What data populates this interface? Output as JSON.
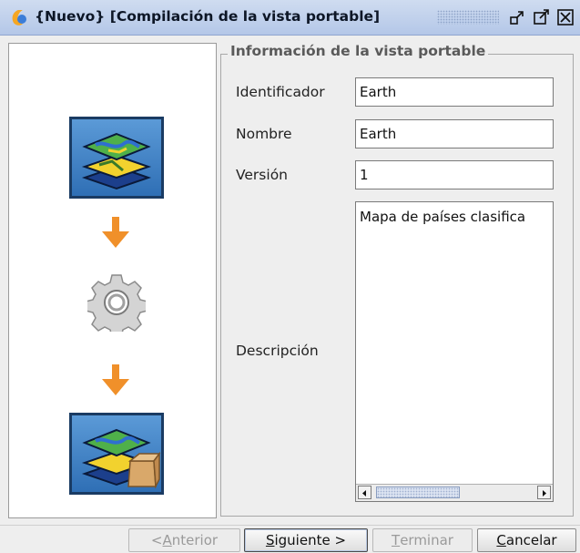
{
  "window": {
    "title": "{Nuevo} [Compilación de la vista portable]"
  },
  "group": {
    "title": "Información de la vista portable"
  },
  "fields": {
    "identifier_label": "Identificador",
    "identifier_value": "Earth",
    "name_label": "Nombre",
    "name_value": "Earth",
    "version_label": "Versión",
    "version_value": "1",
    "description_label": "Descripción",
    "description_value": "Mapa de países clasifica"
  },
  "buttons": {
    "back": {
      "prefix": "< ",
      "mnemonic": "A",
      "rest": "nterior",
      "enabled": false
    },
    "next": {
      "prefix": "",
      "mnemonic": "S",
      "rest": "iguiente >",
      "enabled": true
    },
    "finish": {
      "prefix": "",
      "mnemonic": "T",
      "rest": "erminar",
      "enabled": false
    },
    "cancel": {
      "prefix": "",
      "mnemonic": "C",
      "rest": "ancelar",
      "enabled": true
    }
  },
  "icons": {
    "app": "gvsig-app-icon",
    "minimize": "minimize-icon",
    "maximize": "maximize-icon",
    "close": "close-icon",
    "stage_source": "map-layers-icon",
    "stage_process": "gear-icon",
    "stage_output": "map-layers-package-icon",
    "flow_arrow": "arrow-down-icon"
  },
  "colors": {
    "titlebar": "#b4c7e8",
    "tile_blue": "#2f6fb5",
    "arrow_orange": "#f0902a",
    "window_bg": "#eeeeee"
  }
}
